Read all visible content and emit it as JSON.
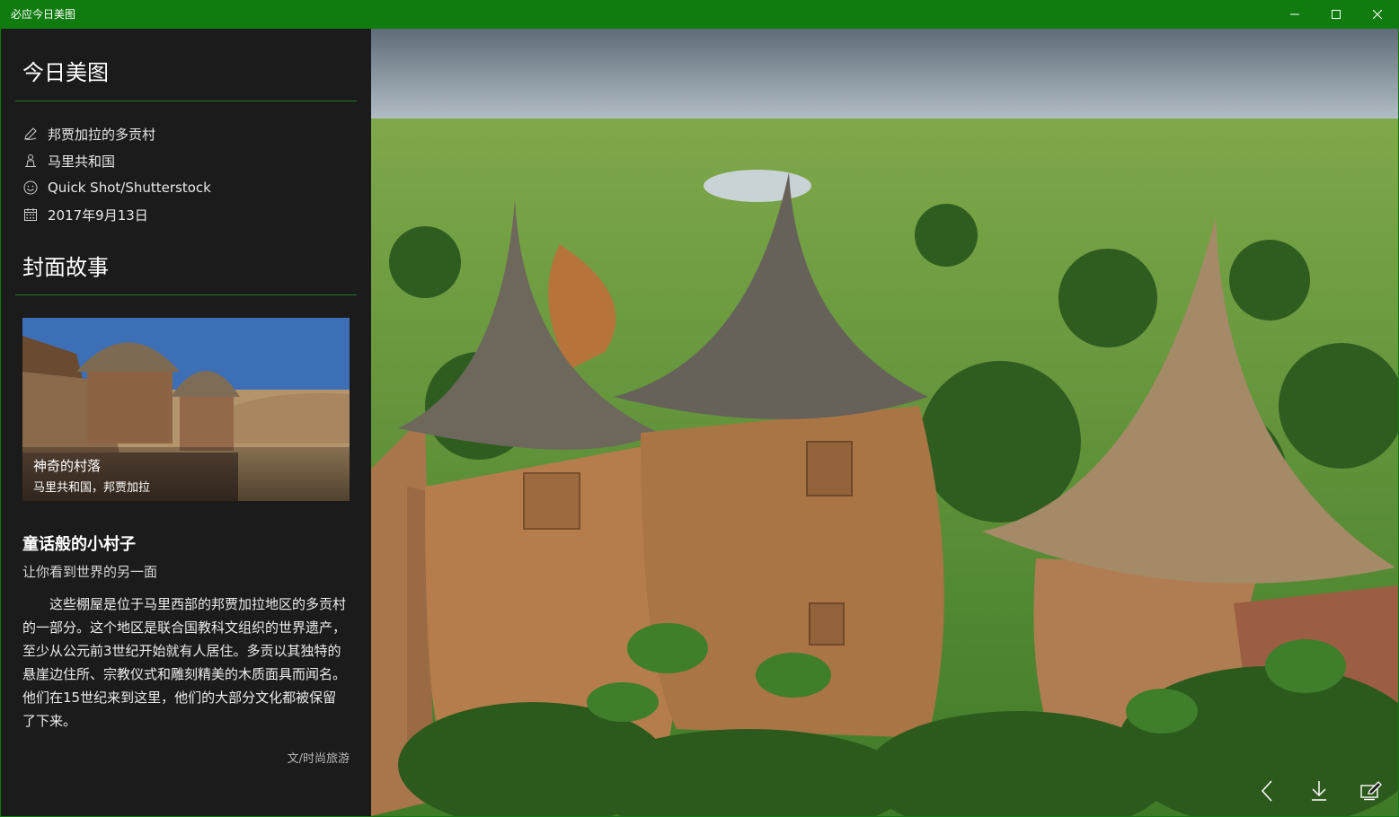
{
  "window": {
    "title": "必应今日美图"
  },
  "sidebar": {
    "today_title": "今日美图",
    "meta": [
      {
        "icon": "pen-icon",
        "text": "邦贾加拉的多贡村"
      },
      {
        "icon": "location-person-icon",
        "text": "马里共和国"
      },
      {
        "icon": "smiley-icon",
        "text": "Quick Shot/Shutterstock"
      },
      {
        "icon": "calendar-icon",
        "text": "2017年9月13日"
      }
    ],
    "cover_story_title": "封面故事",
    "cover": {
      "title": "神奇的村落",
      "subtitle": "马里共和国，邦贾加拉"
    },
    "story": {
      "headline": "童话般的小村子",
      "subheadline": "让你看到世界的另一面",
      "body": "这些棚屋是位于马里西部的邦贾加拉地区的多贡村的一部分。这个地区是联合国教科文组织的世界遗产，至少从公元前3世纪开始就有人居住。多贡以其独特的悬崖边住所、宗教仪式和雕刻精美的木质面具而闻名。他们在15世纪来到这里，他们的大部分文化都被保留了下来。",
      "source": "文/时尚旅游"
    }
  },
  "colors": {
    "titlebar": "#107c10",
    "sidebar_bg": "#1b1b1b",
    "accent_rule": "#1f7a1f"
  },
  "controls": {
    "back": "chevron-left-icon",
    "download": "download-icon",
    "set_wallpaper": "set-wallpaper-icon"
  }
}
